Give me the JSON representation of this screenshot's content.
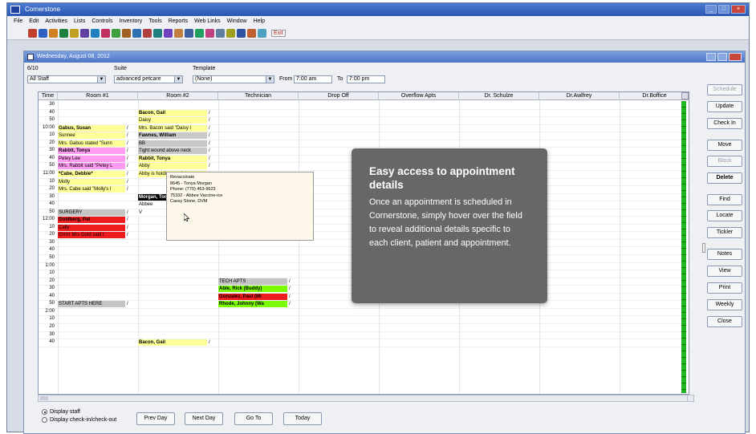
{
  "app": {
    "title": "Cornerstone",
    "menu": [
      "File",
      "Edit",
      "Activities",
      "Lists",
      "Controls",
      "Inventory",
      "Tools",
      "Reports",
      "Web Links",
      "Window",
      "Help"
    ],
    "exit_label": "Exit"
  },
  "window": {
    "title": "Wednesday, August 08, 2012",
    "filters": {
      "staff_label": "6/10",
      "staff_value": "All Staff",
      "suite_label": "Suite",
      "suite_value": "advanced petcare",
      "template_label": "Template",
      "template_value": "(None)",
      "from_label": "From",
      "from_value": "7:00 am",
      "to_label": "To",
      "to_value": "7:00 pm"
    },
    "columns": [
      "Time",
      "Room #1",
      "Room #2",
      "Technician",
      "Drop Off",
      "Overflow Apts",
      "Dr. Schulze",
      "Dr.Awlfrey",
      "Dr.Boffice"
    ],
    "times": [
      "30",
      "40",
      "50",
      "10:00",
      "10",
      "20",
      "30",
      "40",
      "50",
      "11:00",
      "10",
      "20",
      "30",
      "40",
      "50",
      "12:00",
      "10",
      "20",
      "30",
      "40",
      "50",
      "1:00",
      "10",
      "20",
      "30",
      "40",
      "50",
      "2:00",
      "10",
      "20",
      "30",
      "40"
    ],
    "room1": [
      {
        "row": 3,
        "text": "Gabus, Susan",
        "color": "#ffff99",
        "bold": true
      },
      {
        "row": 4,
        "text": "Sunnee",
        "color": "#ffff99"
      },
      {
        "row": 5,
        "text": "Mrs. Gabus stated \"Sunn",
        "color": "#ffff99"
      },
      {
        "row": 6,
        "text": "Rabbit, Tonya",
        "color": "#ff9cf2",
        "bold": true
      },
      {
        "row": 7,
        "text": "Petey Lee",
        "color": "#ff9cf2"
      },
      {
        "row": 8,
        "text": "Mrs. Rabbit said \"Petey L",
        "color": "#ff9cf2"
      },
      {
        "row": 9,
        "text": "*Cabe, Debbie*",
        "color": "#ffff99",
        "bold": true
      },
      {
        "row": 10,
        "text": "Molly",
        "color": "#ffff99"
      },
      {
        "row": 11,
        "text": "Mrs. Cabe said \"Molly's l",
        "color": "#ffff99"
      },
      {
        "row": 14,
        "text": "SURGERY",
        "color": "#c4c4c4"
      },
      {
        "row": 15,
        "text": "Goldberg, Pat",
        "color": "#ee1c1c",
        "bold": true
      },
      {
        "row": 16,
        "text": "Cally",
        "color": "#ee1c1c"
      },
      {
        "row": 17,
        "text": "Grrrrr Mrs Gold said I",
        "color": "#ee1c1c"
      },
      {
        "row": 26,
        "text": "START APTS HERE",
        "color": "#c4c4c4"
      }
    ],
    "room2": [
      {
        "row": 1,
        "text": "Bacon, Gail",
        "color": "#ffff99",
        "bold": true
      },
      {
        "row": 2,
        "text": "Daisy",
        "color": "#ffff99"
      },
      {
        "row": 3,
        "text": "Mrs. Bacon said \"Daisy l",
        "color": "#ffff99"
      },
      {
        "row": 4,
        "text": "Fawnes, William",
        "color": "#c8c8c8",
        "bold": true
      },
      {
        "row": 5,
        "text": "BB",
        "color": "#c8c8c8"
      },
      {
        "row": 6,
        "text": "Tight wound above neck",
        "color": "#c8c8c8"
      },
      {
        "row": 7,
        "text": "Rabbit, Tonya",
        "color": "#ffff99",
        "bold": true
      },
      {
        "row": 8,
        "text": "Abby",
        "color": "#ffff99"
      },
      {
        "row": 9,
        "text": "Abby is holding up right e",
        "color": "#ffff99"
      },
      {
        "row": 12,
        "text": "Morgan, Tonya",
        "color": "#000000",
        "textColor": "#ffffff",
        "bold": true
      },
      {
        "row": 13,
        "text": "Abbee",
        "color": "#ffffff"
      },
      {
        "row": 14,
        "text": "V",
        "color": "#ffffff"
      },
      {
        "row": 31,
        "text": "Bacon, Gail",
        "color": "#ffff99",
        "bold": true
      }
    ],
    "technician": [
      {
        "row": 23,
        "text": "TECH APTS",
        "color": "#c4c4c4"
      },
      {
        "row": 24,
        "text": "Able, Rick (Buddy)",
        "color": "#7cfc00",
        "bold": true
      },
      {
        "row": 25,
        "text": "Gonzalez, Paul (Mi",
        "color": "#ee1c1c",
        "bold": true
      },
      {
        "row": 26,
        "text": "Rhode, Johnny (Wa",
        "color": "#7cfc00",
        "bold": true
      }
    ],
    "tooltip": {
      "lines": [
        "Revaccinate",
        "8645 - Tonya Morgan",
        "Phone: (770) 463-9623",
        "75332 - Abbee Vaccine-ice",
        "Cassy Stone, DVM"
      ]
    },
    "side_buttons": [
      {
        "label": "Schedule",
        "enabled": false
      },
      {
        "label": "Update",
        "enabled": true
      },
      {
        "label": "Check In",
        "enabled": true
      },
      {
        "label": "Move",
        "enabled": true
      },
      {
        "label": "Block",
        "enabled": false
      },
      {
        "label": "Delete",
        "enabled": true,
        "bold": true
      },
      {
        "label": "Find",
        "enabled": true
      },
      {
        "label": "Locate",
        "enabled": true
      },
      {
        "label": "Tickler",
        "enabled": true
      },
      {
        "label": "Notes",
        "enabled": true
      },
      {
        "label": "View",
        "enabled": true
      },
      {
        "label": "Print",
        "enabled": true
      },
      {
        "label": "Weekly",
        "enabled": true
      },
      {
        "label": "Close",
        "enabled": true
      }
    ],
    "display_options": [
      "Display staff",
      "Display check-in/check-out"
    ],
    "bottom_buttons": [
      "Prev Day",
      "Next Day",
      "Go To",
      "Today"
    ]
  },
  "callout": {
    "title": "Easy access to appointment details",
    "body": "Once an appointment is scheduled in Cornerstone, simply hover over the field to reveal additional details specific to each client, patient and appointment."
  }
}
